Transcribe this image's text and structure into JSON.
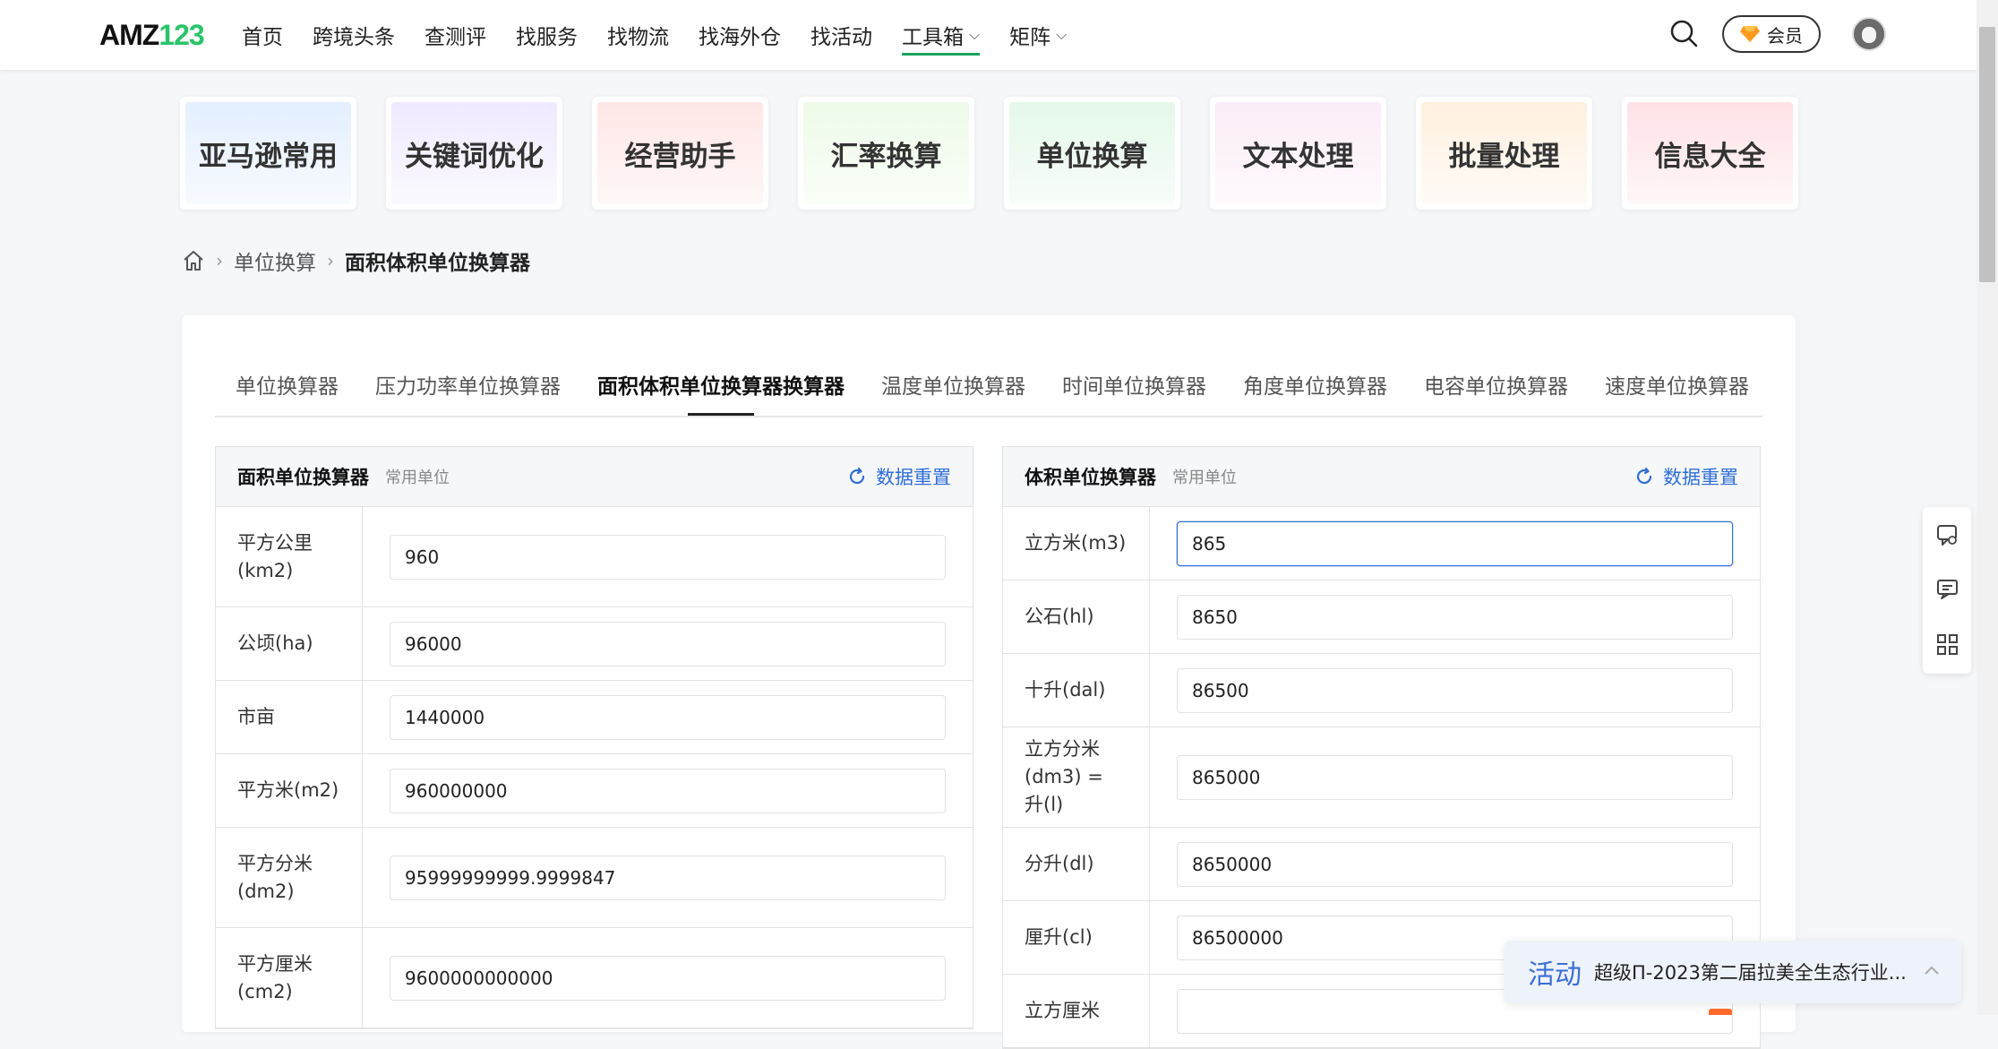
{
  "logo": {
    "part1": "AMZ",
    "part2": "123"
  },
  "nav": {
    "items": [
      {
        "label": "首页"
      },
      {
        "label": "跨境头条"
      },
      {
        "label": "查测评"
      },
      {
        "label": "找服务"
      },
      {
        "label": "找物流"
      },
      {
        "label": "找海外仓"
      },
      {
        "label": "找活动"
      },
      {
        "label": "工具箱",
        "dropdown": true,
        "active": true
      },
      {
        "label": "矩阵",
        "dropdown": true
      }
    ],
    "vip_label": "会员",
    "accent": "#1aa35e"
  },
  "categories": [
    {
      "label": "亚马逊常用",
      "bg": "#e3efff"
    },
    {
      "label": "关键词优化",
      "bg": "#efeaff"
    },
    {
      "label": "经营助手",
      "bg": "#ffe6e6"
    },
    {
      "label": "汇率换算",
      "bg": "#eefbe8"
    },
    {
      "label": "单位换算",
      "bg": "#e4f8ea"
    },
    {
      "label": "文本处理",
      "bg": "#fbecf7"
    },
    {
      "label": "批量处理",
      "bg": "#fff0df"
    },
    {
      "label": "信息大全",
      "bg": "#ffe1e6"
    }
  ],
  "breadcrumb": {
    "level1": "单位换算",
    "current": "面积体积单位换算器"
  },
  "tabs": [
    {
      "label": "单位换算器"
    },
    {
      "label": "压力功率单位换算器"
    },
    {
      "label": "面积体积单位换算器换算器",
      "active": true
    },
    {
      "label": "温度单位换算器"
    },
    {
      "label": "时间单位换算器"
    },
    {
      "label": "角度单位换算器"
    },
    {
      "label": "电容单位换算器"
    },
    {
      "label": "速度单位换算器"
    }
  ],
  "area": {
    "title": "面积单位换算器",
    "subtitle": "常用单位",
    "reset_label": "数据重置",
    "rows": [
      {
        "label": "平方公里\n(km2)",
        "value": "960"
      },
      {
        "label": "公顷(ha)",
        "value": "96000"
      },
      {
        "label": "市亩",
        "value": "1440000"
      },
      {
        "label": "平方米(m2)",
        "value": "960000000"
      },
      {
        "label": "平方分米\n(dm2)",
        "value": "95999999999.9999847"
      },
      {
        "label": "平方厘米\n(cm2)",
        "value": "9600000000000"
      }
    ]
  },
  "volume": {
    "title": "体积单位换算器",
    "subtitle": "常用单位",
    "reset_label": "数据重置",
    "rows": [
      {
        "label": "立方米(m3)",
        "value": "865",
        "focused": true
      },
      {
        "label": "公石(hl)",
        "value": "8650"
      },
      {
        "label": "十升(dal)",
        "value": "86500"
      },
      {
        "label": "立方分米\n(dm3) = 升(l)",
        "value": "865000"
      },
      {
        "label": "分升(dl)",
        "value": "8650000"
      },
      {
        "label": "厘升(cl)",
        "value": "86500000"
      },
      {
        "label": "立方厘米",
        "value": ""
      }
    ]
  },
  "toast": {
    "tag": "活动",
    "message": "超级Π-2023第二届拉美全生态行业..."
  },
  "colors": {
    "link_blue": "#2f6fd6",
    "focus_blue": "#2f6fd6",
    "active_tab": "#222222"
  }
}
